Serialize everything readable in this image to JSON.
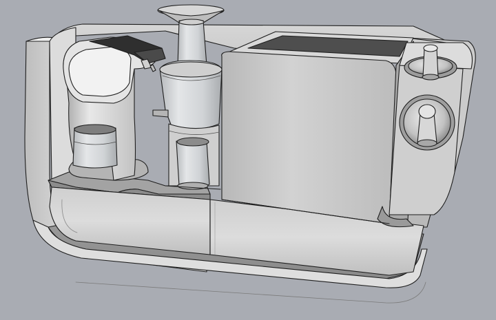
{
  "viewport": {
    "background_color": "#a9acb3",
    "shading_style": "shaded-with-edges",
    "edge_color": "#1e1e1e",
    "surface_light": "#e6e6e6",
    "surface_mid": "#c4c4c4",
    "surface_dark": "#8f8f8f",
    "glass_tint": "#d8dcdf"
  },
  "model": {
    "parts": [
      {
        "name": "enclosure-shell"
      },
      {
        "name": "capsule-coffee-machine"
      },
      {
        "name": "juicer-tower"
      },
      {
        "name": "juicer-cup"
      },
      {
        "name": "appliance-box"
      },
      {
        "name": "valve-upper"
      },
      {
        "name": "valve-lower"
      },
      {
        "name": "front-drawer-left"
      },
      {
        "name": "front-drawer-right"
      }
    ]
  }
}
